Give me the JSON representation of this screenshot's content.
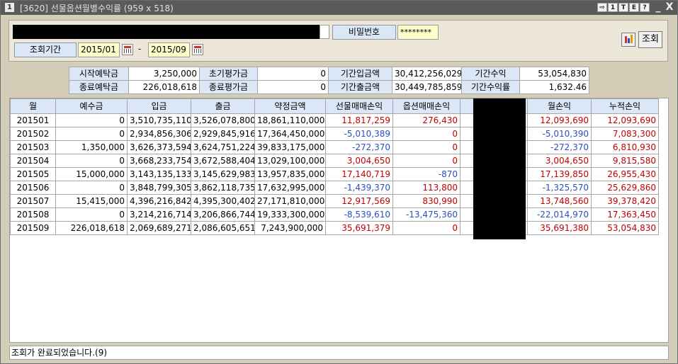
{
  "titlebar": {
    "window_number": "1",
    "title": "[3620]  선물옵션월별수익률  (959 x 518)",
    "buttons": [
      "⇨",
      "1",
      "T",
      "E",
      "?"
    ],
    "minimize": "_",
    "close": "X"
  },
  "search": {
    "password_label": "비밀번호",
    "password_value": "********",
    "period_label": "조회기간",
    "from": "2015/01",
    "dash": "-",
    "to": "2015/09",
    "query_button": "조회"
  },
  "summary": {
    "rows": [
      [
        {
          "label": "시작예탁금",
          "value": "3,250,000"
        },
        {
          "label": "초기평가금",
          "value": "0"
        },
        {
          "label": "기간입금액",
          "value": "30,412,256,029"
        },
        {
          "label": "기간수익",
          "value": "53,054,830"
        }
      ],
      [
        {
          "label": "종료예탁금",
          "value": "226,018,618"
        },
        {
          "label": "종료평가금",
          "value": "0"
        },
        {
          "label": "기간출금액",
          "value": "30,449,785,859"
        },
        {
          "label": "기간수익률",
          "value": "1,632.46"
        }
      ]
    ]
  },
  "grid": {
    "columns": [
      "월",
      "예수금",
      "입금",
      "출금",
      "약정금액",
      "선물매매손익",
      "옵션매매손익",
      "",
      "월손익",
      "누적손익"
    ],
    "rows": [
      {
        "month": "201501",
        "deposit": "0",
        "in": "3,510,735,110",
        "out": "3,526,078,800",
        "contract": "18,861,110,000",
        "fut": "11,817,259",
        "fut_c": "red",
        "opt": "276,430",
        "opt_c": "red",
        "monthly": "12,093,690",
        "monthly_c": "red",
        "cum": "12,093,690",
        "cum_c": "red"
      },
      {
        "month": "201502",
        "deposit": "0",
        "in": "2,934,856,306",
        "out": "2,929,845,916",
        "contract": "17,364,450,000",
        "fut": "-5,010,389",
        "fut_c": "blue",
        "opt": "0",
        "opt_c": "red",
        "monthly": "-5,010,390",
        "monthly_c": "blue",
        "cum": "7,083,300",
        "cum_c": "red"
      },
      {
        "month": "201503",
        "deposit": "1,350,000",
        "in": "3,626,373,594",
        "out": "3,624,751,224",
        "contract": "39,833,175,000",
        "fut": "-272,370",
        "fut_c": "blue",
        "opt": "0",
        "opt_c": "red",
        "monthly": "-272,370",
        "monthly_c": "blue",
        "cum": "6,810,930",
        "cum_c": "red"
      },
      {
        "month": "201504",
        "deposit": "0",
        "in": "3,668,233,754",
        "out": "3,672,588,404",
        "contract": "13,029,100,000",
        "fut": "3,004,650",
        "fut_c": "red",
        "opt": "0",
        "opt_c": "red",
        "monthly": "3,004,650",
        "monthly_c": "red",
        "cum": "9,815,580",
        "cum_c": "red"
      },
      {
        "month": "201505",
        "deposit": "15,000,000",
        "in": "3,143,135,133",
        "out": "3,145,629,983",
        "contract": "13,957,835,000",
        "fut": "17,140,719",
        "fut_c": "red",
        "opt": "-870",
        "opt_c": "blue",
        "monthly": "17,139,850",
        "monthly_c": "red",
        "cum": "26,955,430",
        "cum_c": "red"
      },
      {
        "month": "201506",
        "deposit": "0",
        "in": "3,848,799,305",
        "out": "3,862,118,735",
        "contract": "17,632,995,000",
        "fut": "-1,439,370",
        "fut_c": "blue",
        "opt": "113,800",
        "opt_c": "red",
        "monthly": "-1,325,570",
        "monthly_c": "blue",
        "cum": "25,629,860",
        "cum_c": "red"
      },
      {
        "month": "201507",
        "deposit": "15,415,000",
        "in": "4,396,216,842",
        "out": "4,395,300,402",
        "contract": "27,171,810,000",
        "fut": "12,917,569",
        "fut_c": "red",
        "opt": "830,990",
        "opt_c": "red",
        "monthly": "13,748,560",
        "monthly_c": "red",
        "cum": "39,378,420",
        "cum_c": "red"
      },
      {
        "month": "201508",
        "deposit": "0",
        "in": "3,214,216,714",
        "out": "3,206,866,744",
        "contract": "19,333,300,000",
        "fut": "-8,539,610",
        "fut_c": "blue",
        "opt": "-13,475,360",
        "opt_c": "blue",
        "monthly": "-22,014,970",
        "monthly_c": "blue",
        "cum": "17,363,450",
        "cum_c": "red"
      },
      {
        "month": "201509",
        "deposit": "226,018,618",
        "in": "2,069,689,271",
        "out": "2,086,605,651",
        "contract": "7,243,900,000",
        "fut": "35,691,379",
        "fut_c": "red",
        "opt": "0",
        "opt_c": "red",
        "monthly": "35,691,380",
        "monthly_c": "red",
        "cum": "53,054,830",
        "cum_c": "red"
      }
    ]
  },
  "status": "조회가 완료되었습니다.(9)"
}
